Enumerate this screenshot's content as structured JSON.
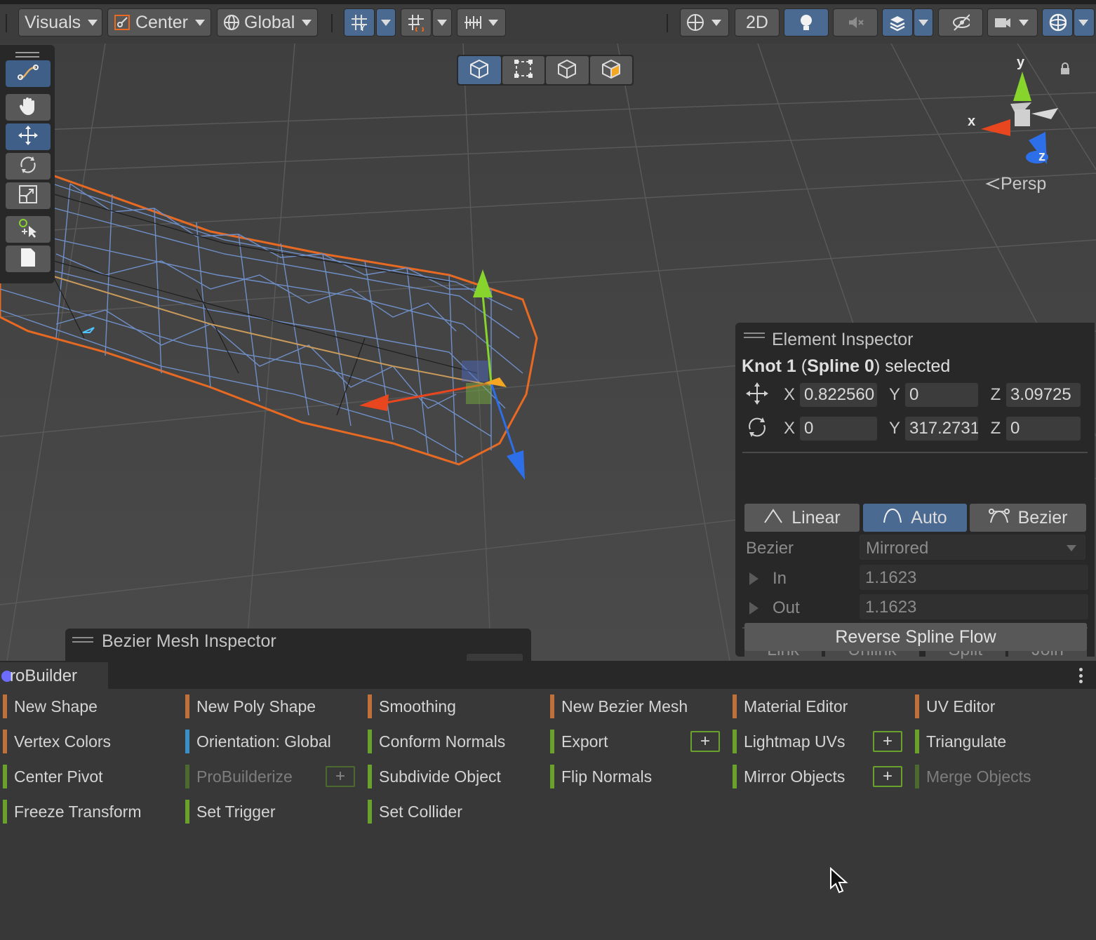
{
  "toolbar": {
    "visuals_label": "Visuals",
    "pivot_label": "Center",
    "space_label": "Global",
    "mode_2d_label": "2D"
  },
  "tools": [
    "spline-tool",
    "hand-tool",
    "move-tool",
    "rotate-tool",
    "scale-tool",
    "custom-tool",
    "page-tool"
  ],
  "scene": {
    "gizmo": {
      "y_label": "y",
      "x_label": "x",
      "z_label": "z",
      "projection_label": "Persp"
    }
  },
  "element_inspector": {
    "title": "Element Inspector",
    "selected_knot": "Knot 1",
    "selected_spline": "Spline 0",
    "selected_suffix": "selected",
    "position": {
      "x_label": "X",
      "x": "0.822560",
      "y_label": "Y",
      "y": "0",
      "z_label": "Z",
      "z": "3.09725"
    },
    "rotation": {
      "x_label": "X",
      "x": "0",
      "y_label": "Y",
      "y": "317.2731",
      "z_label": "Z",
      "z": "0"
    },
    "tangent_modes": {
      "linear": "Linear",
      "auto": "Auto",
      "bezier": "Bezier"
    },
    "bezier_label": "Bezier",
    "bezier_value": "Mirrored",
    "in_label": "In",
    "in_value": "1.1623",
    "out_label": "Out",
    "out_value": "1.1623",
    "actions": {
      "link": "Link",
      "unlink": "Unlink",
      "split": "Split",
      "join": "Join"
    },
    "reverse_label": "Reverse Spline Flow"
  },
  "mesh_inspector": {
    "title": "Bezier Mesh Inspector"
  },
  "probuilder": {
    "tab_label": "roBuilder",
    "items": [
      {
        "label": "New Shape",
        "color": "#c0703a",
        "dim": false
      },
      {
        "label": "Vertex Colors",
        "color": "#c0703a",
        "dim": false
      },
      {
        "label": "Center Pivot",
        "color": "#6aa02c",
        "dim": false
      },
      {
        "label": "Freeze Transform",
        "color": "#6aa02c",
        "dim": false
      },
      {
        "label": "New Poly Shape",
        "color": "#c0703a",
        "dim": false
      },
      {
        "label": "Orientation: Global",
        "color": "#3a8fc6",
        "dim": false
      },
      {
        "label": "ProBuilderize",
        "color": "#4c6a30",
        "dim": true
      },
      {
        "label": "Set Trigger",
        "color": "#6aa02c",
        "dim": false
      },
      {
        "label": "Smoothing",
        "color": "#c0703a",
        "dim": false
      },
      {
        "label": "Conform Normals",
        "color": "#6aa02c",
        "dim": false
      },
      {
        "label": "Subdivide Object",
        "color": "#6aa02c",
        "dim": false
      },
      {
        "label": "Set Collider",
        "color": "#6aa02c",
        "dim": false
      },
      {
        "label": "New Bezier Mesh",
        "color": "#c0703a",
        "dim": false
      },
      {
        "label": "Export",
        "color": "#6aa02c",
        "dim": false
      },
      {
        "label": "Flip Normals",
        "color": "#6aa02c",
        "dim": false
      },
      {
        "label": "Material Editor",
        "color": "#c0703a",
        "dim": false
      },
      {
        "label": "Lightmap UVs",
        "color": "#6aa02c",
        "dim": false
      },
      {
        "label": "Mirror Objects",
        "color": "#6aa02c",
        "dim": false
      },
      {
        "label": "UV Editor",
        "color": "#c0703a",
        "dim": false
      },
      {
        "label": "Triangulate",
        "color": "#6aa02c",
        "dim": false
      },
      {
        "label": "Merge Objects",
        "color": "#4c6a30",
        "dim": true
      }
    ],
    "plus_label": "+"
  },
  "colors": {
    "accent": "#4b6a91",
    "selection_outline": "#e86a22",
    "wire": "#6f8fc8",
    "x_axis": "#e8461e",
    "y_axis": "#86d42c",
    "z_axis": "#2d6fe8"
  }
}
